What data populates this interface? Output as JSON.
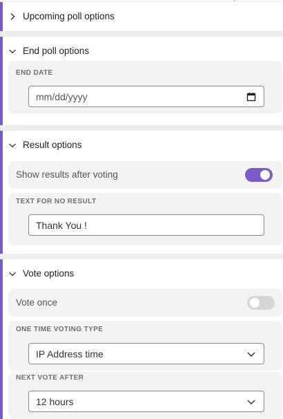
{
  "sections": {
    "upcoming": {
      "title": "Upcoming poll options",
      "expanded": false
    },
    "end_poll": {
      "title": "End poll options",
      "end_date_label": "END DATE",
      "end_date_placeholder": "mm/dd/yyyy"
    },
    "result": {
      "title": "Result options",
      "show_results_label": "Show results after voting",
      "show_results_enabled": true,
      "no_result_label": "TEXT FOR NO RESULT",
      "no_result_value": "Thank You !"
    },
    "vote": {
      "title": "Vote options",
      "vote_once_label": "Vote once",
      "vote_once_enabled": false,
      "voting_type_label": "ONE TIME VOTING TYPE",
      "voting_type_value": "IP Address time",
      "next_vote_label": "NEXT VOTE AFTER",
      "next_vote_value": "12 hours"
    }
  },
  "colors": {
    "accent": "#7b5cc6",
    "toggle_off": "#d6d6d6",
    "card_bg": "#f3f3f3"
  },
  "icons": [
    "chevron-right-icon",
    "chevron-down-icon",
    "calendar-icon"
  ]
}
